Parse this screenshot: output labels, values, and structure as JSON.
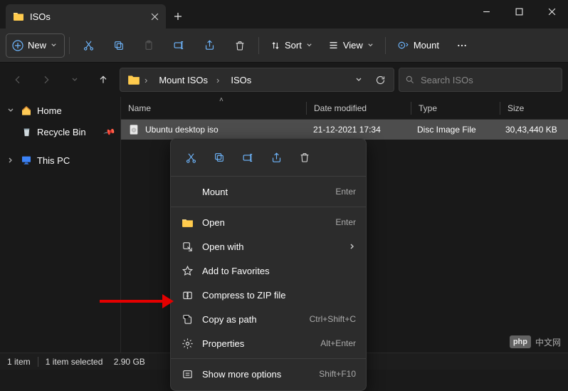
{
  "titlebar": {
    "tab_title": "ISOs"
  },
  "toolbar": {
    "new": "New",
    "sort": "Sort",
    "view": "View",
    "mount": "Mount"
  },
  "breadcrumb": {
    "item1": "Mount ISOs",
    "item2": "ISOs"
  },
  "search": {
    "placeholder": "Search ISOs"
  },
  "sidebar": {
    "home": "Home",
    "recycle": "Recycle Bin",
    "thispc": "This PC"
  },
  "columns": {
    "name": "Name",
    "date": "Date modified",
    "type": "Type",
    "size": "Size"
  },
  "file": {
    "name": "Ubuntu desktop.iso",
    "name_visible": "Ubuntu desktop iso",
    "date": "21-12-2021 17:34",
    "type": "Disc Image File",
    "size": "30,43,440 KB"
  },
  "context": {
    "mount": "Mount",
    "mount_kbd": "Enter",
    "open": "Open",
    "open_kbd": "Enter",
    "openwith": "Open with",
    "fav": "Add to Favorites",
    "zip": "Compress to ZIP file",
    "copypath": "Copy as path",
    "copypath_kbd": "Ctrl+Shift+C",
    "props": "Properties",
    "props_kbd": "Alt+Enter",
    "more": "Show more options",
    "more_kbd": "Shift+F10"
  },
  "status": {
    "count": "1 item",
    "sel": "1 item selected",
    "size": "2.90 GB"
  },
  "watermark": {
    "tag": "php",
    "cn": "中文网"
  }
}
